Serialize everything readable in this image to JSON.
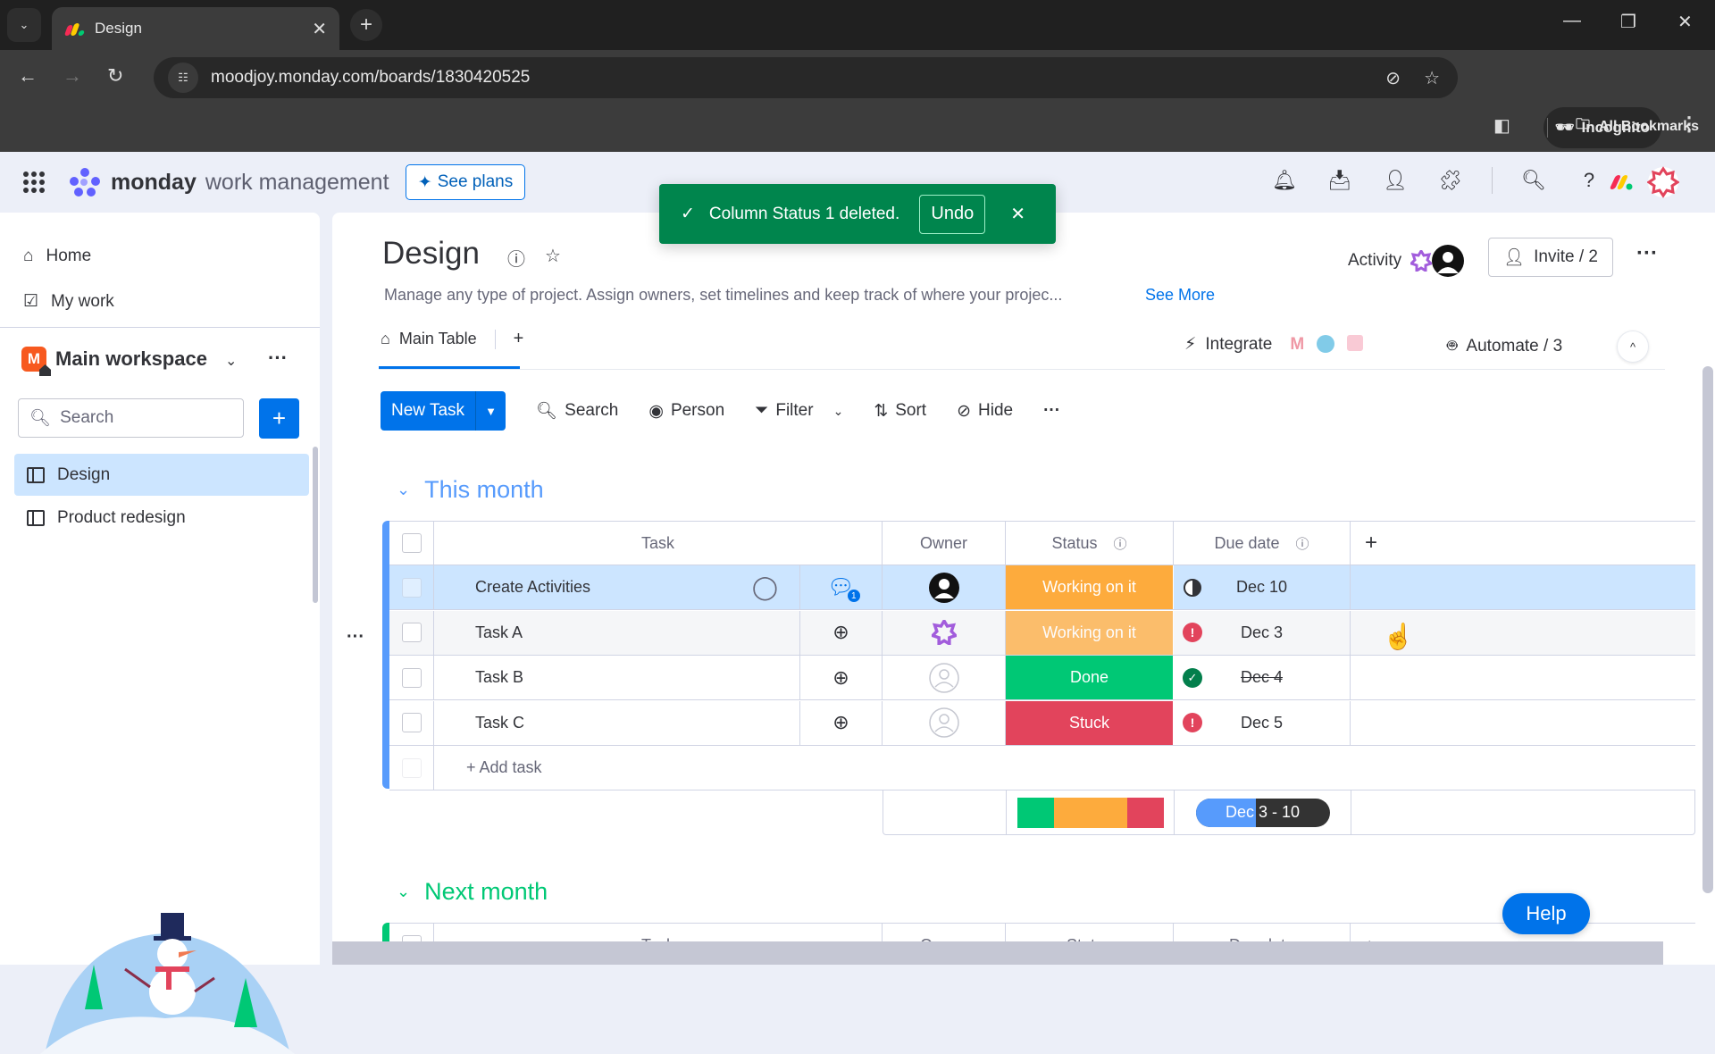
{
  "browser": {
    "tab_title": "Design",
    "url": "moodjoy.monday.com/boards/1830420525",
    "profile_label": "Incognito",
    "bookmarks_label": "All Bookmarks"
  },
  "app": {
    "brand": "monday",
    "product": "work management",
    "see_plans_label": "See plans"
  },
  "toast": {
    "message": "Column Status 1 deleted.",
    "undo_label": "Undo"
  },
  "sidebar": {
    "nav": [
      {
        "label": "Home",
        "icon": "home-icon"
      },
      {
        "label": "My work",
        "icon": "calendar-check-icon"
      }
    ],
    "workspace": {
      "initial": "M",
      "name": "Main workspace"
    },
    "search_placeholder": "Search",
    "boards": [
      {
        "label": "Design",
        "active": true
      },
      {
        "label": "Product redesign",
        "active": false
      }
    ]
  },
  "board": {
    "title": "Design",
    "description": "Manage any type of project. Assign owners, set timelines and keep track of where your projec...",
    "see_more_label": "See More",
    "activity_label": "Activity",
    "invite_label": "Invite / 2",
    "views": [
      {
        "label": "Main Table"
      }
    ],
    "integrate_label": "Integrate",
    "automate_label": "Automate / 3"
  },
  "toolbar": {
    "new_task_label": "New Task",
    "search_label": "Search",
    "person_label": "Person",
    "filter_label": "Filter",
    "sort_label": "Sort",
    "hide_label": "Hide"
  },
  "columns": {
    "task": "Task",
    "owner": "Owner",
    "status": "Status",
    "due_date": "Due date"
  },
  "groups": [
    {
      "title": "This month",
      "color": "#579bfc",
      "rows": [
        {
          "task": "Create Activities",
          "owner": "user-avatar",
          "status": "Working on it",
          "status_color": "#fdab3d",
          "due": "Dec 10",
          "due_state": "in-progress",
          "updates": 1,
          "selected": true
        },
        {
          "task": "Task A",
          "owner": "team-avatar",
          "status": "Working on it",
          "status_color": "#fdab3d",
          "due": "Dec 3",
          "due_state": "overdue",
          "updates": 0,
          "hovered": true
        },
        {
          "task": "Task B",
          "owner": "empty",
          "status": "Done",
          "status_color": "#00c875",
          "due": "Dec 4",
          "due_state": "done",
          "updates": 0
        },
        {
          "task": "Task C",
          "owner": "empty",
          "status": "Stuck",
          "status_color": "#e2445c",
          "due": "Dec 5",
          "due_state": "overdue",
          "updates": 0
        }
      ],
      "add_task_label": "+ Add task",
      "summary": {
        "status_distribution": [
          {
            "status": "Done",
            "color": "#00c875",
            "fraction": 0.25
          },
          {
            "status": "Working on it",
            "color": "#fdab3d",
            "fraction": 0.5
          },
          {
            "status": "Stuck",
            "color": "#e2445c",
            "fraction": 0.25
          }
        ],
        "timeline_label": "Dec 3 - 10",
        "timeline_progress": 0.45
      }
    },
    {
      "title": "Next month",
      "color": "#00c875"
    }
  ],
  "help_label": "Help"
}
